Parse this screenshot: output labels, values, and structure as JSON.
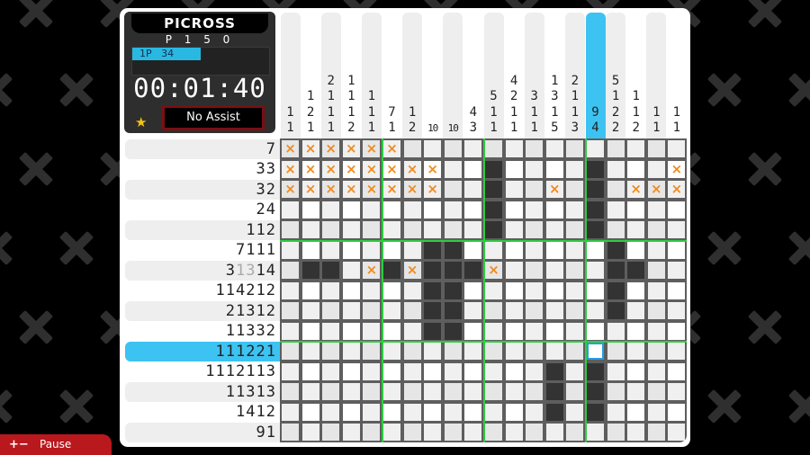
{
  "game": {
    "title": "PICROSS",
    "puzzle_id": "P 1 5 0",
    "player_label": "1P",
    "player_value": "34",
    "player_progress": 0.5,
    "timer": "00:01:40",
    "assist_label": "No Assist",
    "star_icon": "★",
    "cursor": {
      "row": 11,
      "col": 16
    }
  },
  "column_clues": [
    [
      "1",
      "1"
    ],
    [
      "1",
      "2",
      "1"
    ],
    [
      "2",
      "1",
      "1",
      "1"
    ],
    [
      "1",
      "1",
      "1",
      "2"
    ],
    [
      "1",
      "1",
      "1"
    ],
    [
      "7",
      "1"
    ],
    [
      "1",
      "2"
    ],
    [
      "10"
    ],
    [
      "10"
    ],
    [
      "4",
      "3"
    ],
    [
      "5",
      "1",
      "1"
    ],
    [
      "4",
      "2",
      "1",
      "1"
    ],
    [
      "3",
      "1",
      "1"
    ],
    [
      "1",
      "3",
      "1",
      "5"
    ],
    [
      "2",
      "1",
      "1",
      "3"
    ],
    [
      "9",
      "4"
    ],
    [
      "5",
      "1",
      "2",
      "2"
    ],
    [
      "1",
      "1",
      "2"
    ],
    [
      "1",
      "1"
    ],
    [
      "1",
      "1"
    ]
  ],
  "row_clues": [
    {
      "nums": [
        "7"
      ]
    },
    {
      "nums": [
        "3",
        "3"
      ]
    },
    {
      "nums": [
        "3",
        "2"
      ]
    },
    {
      "nums": [
        "2",
        "4"
      ]
    },
    {
      "nums": [
        "1",
        "1",
        "2"
      ]
    },
    {
      "nums": [
        "7",
        "1",
        "1",
        "1"
      ]
    },
    {
      "nums": [
        "3",
        "1",
        "3",
        "1",
        "4"
      ],
      "done": [
        1,
        2
      ]
    },
    {
      "nums": [
        "1",
        "1",
        "4",
        "2",
        "1",
        "2"
      ]
    },
    {
      "nums": [
        "2",
        "1",
        "3",
        "1",
        "2"
      ]
    },
    {
      "nums": [
        "1",
        "1",
        "3",
        "3",
        "2"
      ]
    },
    {
      "nums": [
        "1",
        "1",
        "1",
        "2",
        "2",
        "1"
      ]
    },
    {
      "nums": [
        "1",
        "1",
        "1",
        "2",
        "1",
        "1",
        "3"
      ]
    },
    {
      "nums": [
        "1",
        "1",
        "3",
        "1",
        "3"
      ]
    },
    {
      "nums": [
        "1",
        "4",
        "1",
        "2"
      ]
    },
    {
      "nums": [
        "9",
        "1"
      ]
    }
  ],
  "grid_rows": [
    "XXXXXX..............",
    "XXXXXXXX..#....#...XX",
    "XXXXXXXX..#..X.#.XXX",
    "..........#....#....",
    "..........#....#....",
    ".......##.......#....",
    ".##.X#X###X.....##...",
    ".......##.......#....",
    ".......##.......#....",
    ".......##...........",
    "....................",
    ".............#.#....",
    ".............#.#....",
    ".............#.#....",
    "...................."
  ],
  "pause": {
    "icon": "+−",
    "label": "Pause"
  },
  "colors": {
    "accent": "#3dc3f2",
    "filled": "#333333",
    "mark": "#f28a1d",
    "guide": "#2ecc40",
    "pause": "#b9181d"
  }
}
